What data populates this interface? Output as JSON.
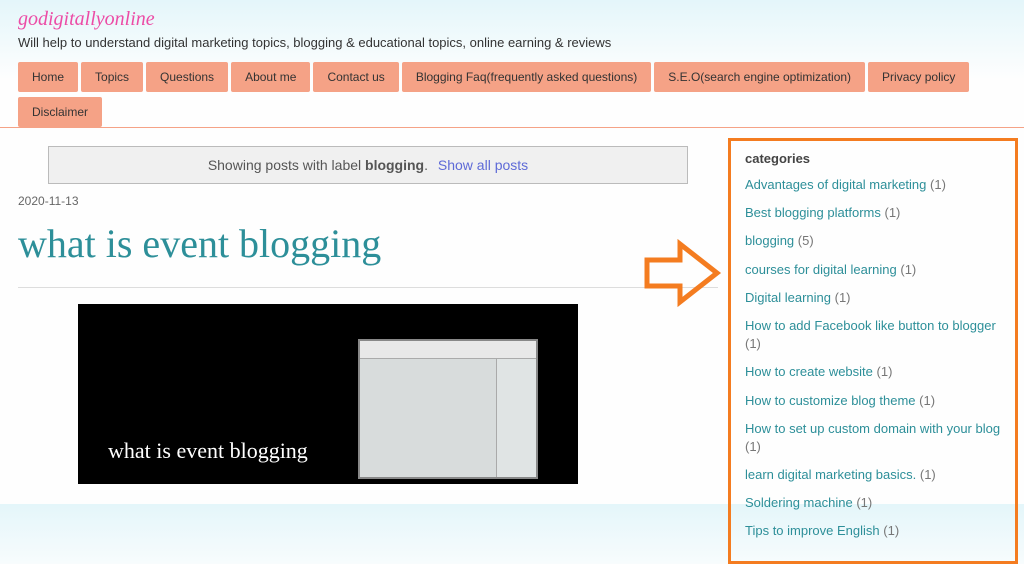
{
  "site": {
    "title": "godigitallyonline",
    "desc": "Will help to understand digital marketing topics, blogging & educational topics, online earning & reviews"
  },
  "nav": {
    "row1": [
      "Home",
      "Topics",
      "Questions",
      "About me",
      "Contact us",
      "Blogging Faq(frequently asked questions)",
      "S.E.O(search engine optimization)",
      "Privacy policy"
    ],
    "row2": [
      "Disclaimer"
    ]
  },
  "status": {
    "prefix": "Showing posts with label ",
    "label": "blogging",
    "suffix": ". ",
    "show_all": "Show all posts"
  },
  "post": {
    "date": "2020-11-13",
    "title": "what is event blogging",
    "video_text": "what is event blogging"
  },
  "sidebar": {
    "title": "categories",
    "items": [
      {
        "name": "Advantages of digital marketing",
        "count": "(1)"
      },
      {
        "name": "Best blogging platforms",
        "count": "(1)"
      },
      {
        "name": "blogging",
        "count": "(5)"
      },
      {
        "name": "courses for digital learning",
        "count": "(1)"
      },
      {
        "name": "Digital learning",
        "count": "(1)"
      },
      {
        "name": "How to add Facebook like button to blogger",
        "count": "(1)"
      },
      {
        "name": "How to create website",
        "count": "(1)"
      },
      {
        "name": "How to customize blog theme",
        "count": "(1)"
      },
      {
        "name": "How to set up custom domain with your blog",
        "count": "(1)"
      },
      {
        "name": "learn digital marketing basics.",
        "count": "(1)"
      },
      {
        "name": "Soldering machine",
        "count": "(1)"
      },
      {
        "name": "Tips to improve English",
        "count": "(1)"
      }
    ]
  }
}
